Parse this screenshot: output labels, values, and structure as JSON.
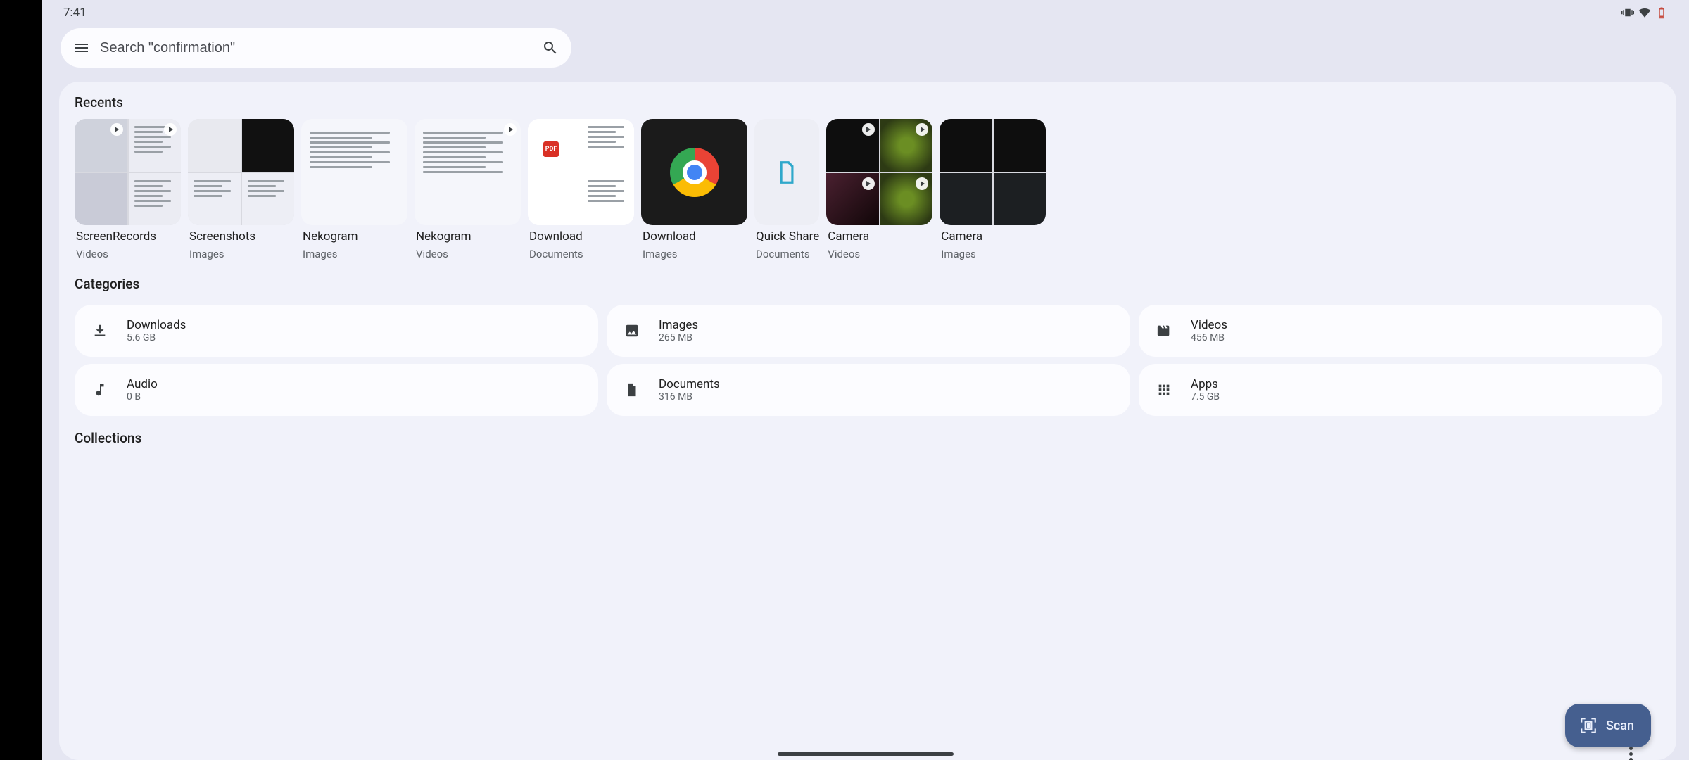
{
  "status": {
    "time": "7:41"
  },
  "search": {
    "placeholder": "Search \"confirmation\""
  },
  "sections": {
    "recents": "Recents",
    "categories": "Categories",
    "collections": "Collections"
  },
  "recents": [
    {
      "title": "ScreenRecords",
      "sub": "Videos"
    },
    {
      "title": "Screenshots",
      "sub": "Images"
    },
    {
      "title": "Nekogram",
      "sub": "Images"
    },
    {
      "title": "Nekogram",
      "sub": "Videos"
    },
    {
      "title": "Download",
      "sub": "Documents"
    },
    {
      "title": "Download",
      "sub": "Images"
    },
    {
      "title": "Quick Share",
      "sub": "Documents"
    },
    {
      "title": "Camera",
      "sub": "Videos"
    },
    {
      "title": "Camera",
      "sub": "Images"
    }
  ],
  "categories": [
    {
      "title": "Downloads",
      "sub": "5.6 GB",
      "icon": "download"
    },
    {
      "title": "Images",
      "sub": "265 MB",
      "icon": "image"
    },
    {
      "title": "Videos",
      "sub": "456 MB",
      "icon": "movie"
    },
    {
      "title": "Audio",
      "sub": "0 B",
      "icon": "music"
    },
    {
      "title": "Documents",
      "sub": "316 MB",
      "icon": "file"
    },
    {
      "title": "Apps",
      "sub": "7.5 GB",
      "icon": "apps"
    }
  ],
  "fab": {
    "label": "Scan"
  },
  "icons": {
    "pdf_label": "PDF"
  }
}
